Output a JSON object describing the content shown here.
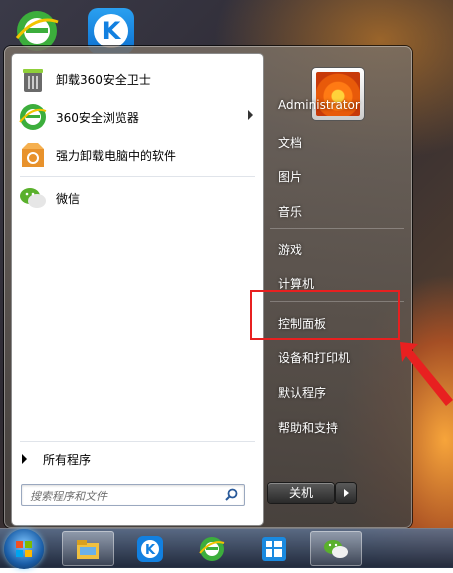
{
  "pinned_items": [
    {
      "label": "卸载360安全卫士",
      "icon": "uninstall-360-icon",
      "has_submenu": false
    },
    {
      "label": "360安全浏览器",
      "icon": "browser-360-icon",
      "has_submenu": true
    },
    {
      "label": "强力卸载电脑中的软件",
      "icon": "uninstaller-box-icon",
      "has_submenu": false
    },
    {
      "label": "微信",
      "icon": "wechat-icon",
      "has_submenu": false
    }
  ],
  "all_programs_label": "所有程序",
  "search": {
    "placeholder": "搜索程序和文件"
  },
  "right_items": [
    {
      "label": "Administrator"
    },
    {
      "label": "文档"
    },
    {
      "label": "图片"
    },
    {
      "label": "音乐"
    },
    {
      "label": "游戏"
    },
    {
      "label": "计算机"
    },
    {
      "label": "控制面板",
      "highlighted": true
    },
    {
      "label": "设备和打印机"
    },
    {
      "label": "默认程序"
    },
    {
      "label": "帮助和支持"
    }
  ],
  "shutdown_label": "关机",
  "colors": {
    "highlight": "#e82020",
    "accent": "#1280e0"
  },
  "taskbar": [
    "start-orb",
    "file-explorer-icon",
    "kugou-icon",
    "browser-360-icon",
    "taskbar-app-icon",
    "wechat-icon"
  ]
}
